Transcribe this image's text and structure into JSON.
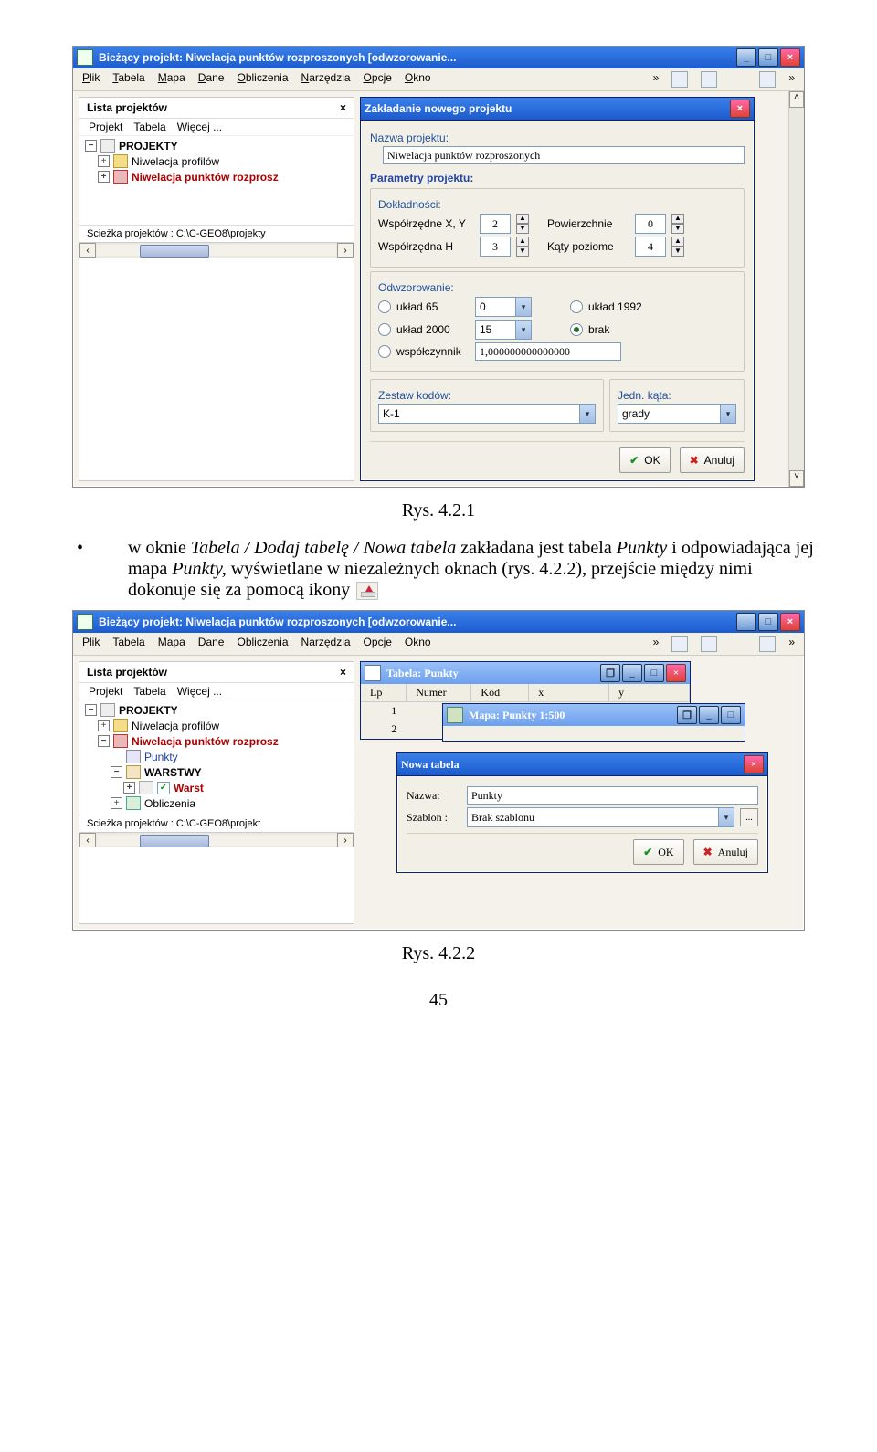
{
  "captions": {
    "fig1": "Rys. 4.2.1",
    "fig2": "Rys. 4.2.2"
  },
  "para1_prefix": "w oknie ",
  "para1_i1": "Tabela / Dodaj tabelę / Nowa tabela",
  "para1_mid": " zakładana jest tabela ",
  "para1_i2": "Punkty",
  "para1_mid2": " i odpowiadająca jej mapa ",
  "para1_i3": "Punkty,",
  "para1_mid3": " wyświetlane w niezależnych oknach (rys. 4.2.2), przejście między nimi dokonuje się za pomocą ikony ",
  "page_number": "45",
  "sc1": {
    "main_title": "Bieżący projekt: Niwelacja punktów rozproszonych [odwzorowanie...",
    "menu": [
      "Plik",
      "Tabela",
      "Mapa",
      "Dane",
      "Obliczenia",
      "Narzędzia",
      "Opcje",
      "Okno"
    ],
    "chev": "»",
    "side": {
      "title": "Lista projektów",
      "close_x": "×",
      "menu": [
        "Projekt",
        "Tabela",
        "Więcej ..."
      ],
      "root": "PROJEKTY",
      "item1": "Niwelacja profilów",
      "item2": "Niwelacja punktów rozprosz",
      "status": "Scieżka projektów : C:\\C-GEO8\\projekty",
      "arrow_l": "‹",
      "arrow_r": "›"
    },
    "dlg": {
      "title": "Zakładanie nowego projektu",
      "lbl_name": "Nazwa projektu:",
      "name_value": "Niwelacja punktów rozproszonych",
      "lbl_params": "Parametry projektu:",
      "lbl_accuracy": "Dokładności:",
      "row_xy": "Współrzędne X, Y",
      "val_xy": "2",
      "row_pow": "Powierzchnie",
      "val_pow": "0",
      "row_h": "Współrzędna H",
      "val_h": "3",
      "row_kat": "Kąty poziome",
      "val_kat": "4",
      "lbl_map": "Odwzorowanie:",
      "r1": "układ 65",
      "r1_combo": "0",
      "r2": "układ 1992",
      "r3": "układ 2000",
      "r3_combo": "15",
      "r4": "brak",
      "r5": "współczynnik",
      "r5_val": "1,000000000000000",
      "lbl_codes": "Zestaw kodów:",
      "codes_val": "K-1",
      "lbl_ang": "Jedn. kąta:",
      "ang_val": "grady",
      "ok": "OK",
      "cancel": "Anuluj"
    }
  },
  "sc2": {
    "main_title": "Bieżący projekt: Niwelacja punktów rozproszonych [odwzorowanie...",
    "menu": [
      "Plik",
      "Tabela",
      "Mapa",
      "Dane",
      "Obliczenia",
      "Narzędzia",
      "Opcje",
      "Okno"
    ],
    "chev": "»",
    "side": {
      "title": "Lista projektów",
      "close_x": "×",
      "menu": [
        "Projekt",
        "Tabela",
        "Więcej ..."
      ],
      "root": "PROJEKTY",
      "item1": "Niwelacja profilów",
      "item2": "Niwelacja punktów rozprosz",
      "sub_punkty": "Punkty",
      "sub_warstwy": "WARSTWY",
      "sub_warst_red": "Warst",
      "sub_oblicz": "Obliczenia",
      "status": "Scieżka projektów : C:\\C-GEO8\\projekt",
      "arrow_l": "‹",
      "arrow_r": "›"
    },
    "tabela_win": {
      "title": "Tabela: Punkty",
      "cols": [
        "Lp",
        "Numer",
        "Kod",
        "x",
        "y"
      ],
      "r1_lp": "1",
      "r2_lp": "2"
    },
    "mapa_win": {
      "title": "Mapa: Punkty  1:500"
    },
    "new_table_dlg": {
      "title": "Nowa tabela",
      "lbl_name": "Nazwa:",
      "name_val": "Punkty",
      "lbl_tmpl": "Szablon :",
      "tmpl_val": "Brak szablonu",
      "dots": "...",
      "ok": "OK",
      "cancel": "Anuluj"
    }
  }
}
